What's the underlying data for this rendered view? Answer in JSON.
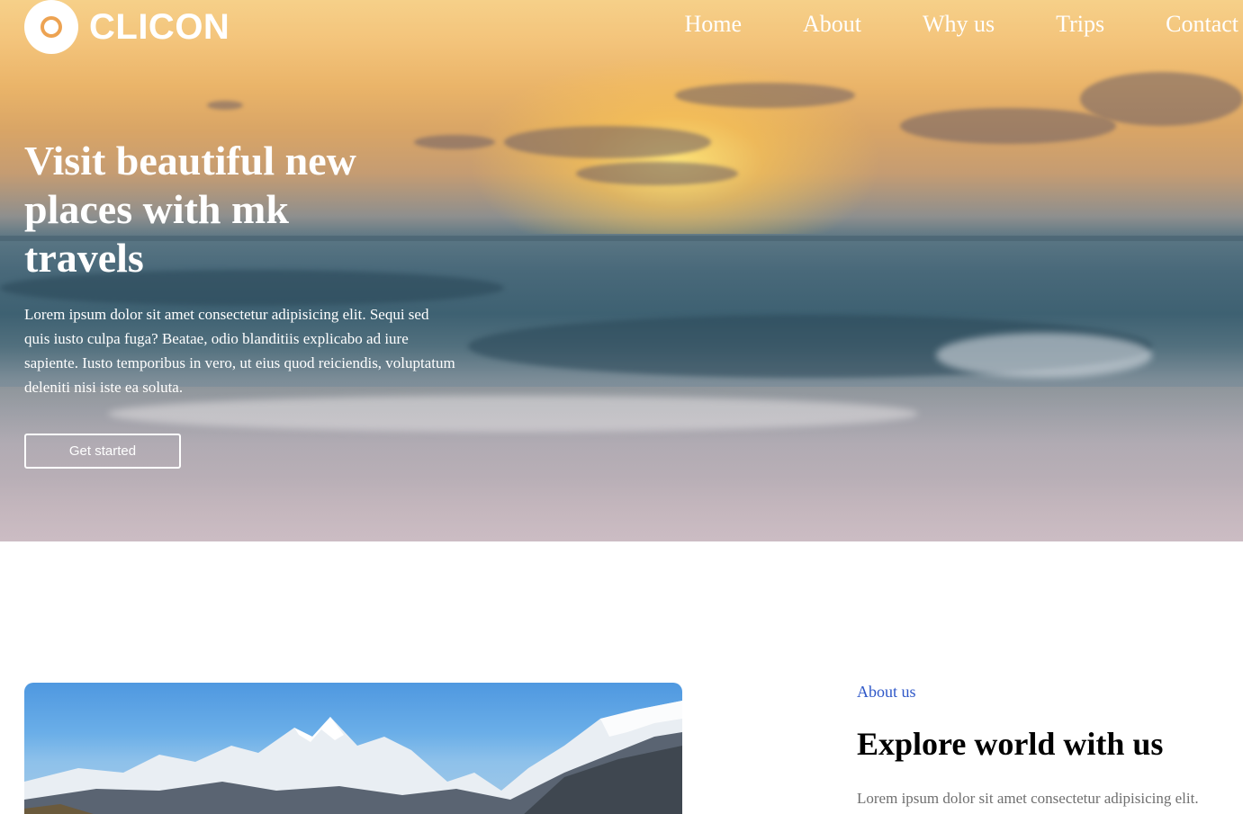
{
  "brand": {
    "name": "CLICON"
  },
  "nav": {
    "items": [
      {
        "label": "Home"
      },
      {
        "label": "About"
      },
      {
        "label": "Why us"
      },
      {
        "label": "Trips"
      },
      {
        "label": "Contact"
      }
    ]
  },
  "hero": {
    "title": "Visit beautiful new places with mk travels",
    "description": "Lorem ipsum dolor sit amet consectetur adipisicing elit. Sequi sed quis iusto culpa fuga? Beatae, odio blanditiis explicabo ad iure sapiente. Iusto temporibus in vero, ut eius quod reiciendis, voluptatum deleniti nisi iste ea soluta.",
    "cta_label": "Get started",
    "background_image": "sunset-over-ocean-waves"
  },
  "about": {
    "kicker": "About us",
    "title": "Explore world with us",
    "text": "Lorem ipsum dolor sit amet consectetur adipisicing elit.",
    "image": "snowy-mountain-range"
  },
  "colors": {
    "accent_link": "#2e57c8",
    "hero_text": "#ffffff",
    "body_text": "#6f6f6f"
  }
}
